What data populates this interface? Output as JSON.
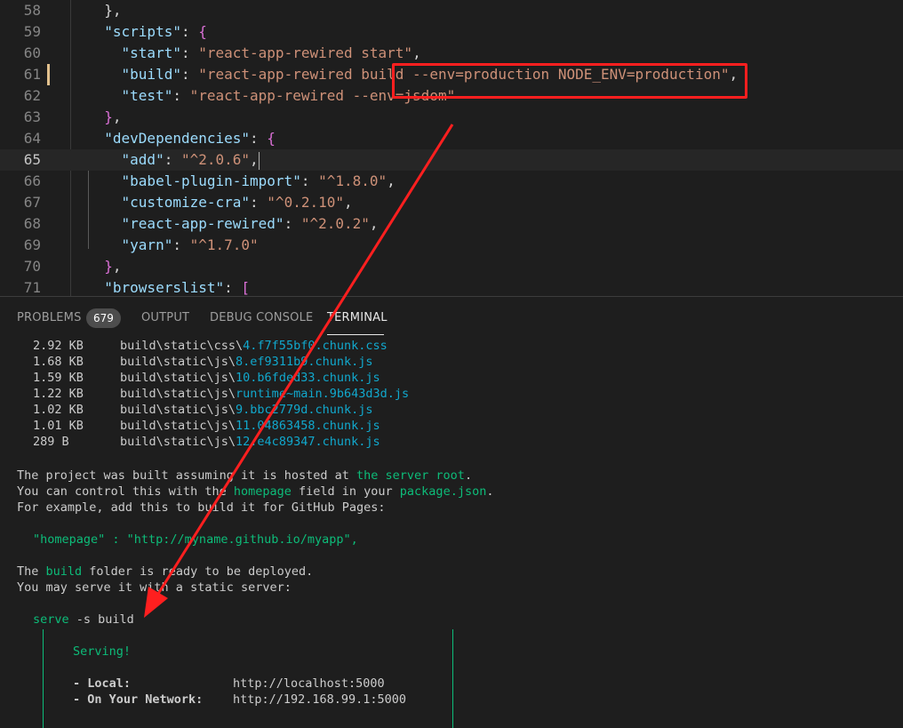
{
  "editor": {
    "lines": [
      {
        "num": "58",
        "parts": [
          [
            "p",
            "  },"
          ]
        ]
      },
      {
        "num": "59",
        "parts": [
          [
            "k",
            "  \"scripts\""
          ],
          [
            "p",
            ": "
          ],
          [
            "b1",
            "{"
          ]
        ]
      },
      {
        "num": "60",
        "parts": [
          [
            "k",
            "    \"start\""
          ],
          [
            "p",
            ": "
          ],
          [
            "s",
            "\"react-app-rewired start\""
          ],
          [
            "p",
            ","
          ]
        ]
      },
      {
        "num": "61",
        "parts": [
          [
            "k",
            "    \"build\""
          ],
          [
            "p",
            ": "
          ],
          [
            "s",
            "\"react-app-rewired build --env=production NODE_ENV=production\""
          ],
          [
            "p",
            ","
          ]
        ]
      },
      {
        "num": "62",
        "parts": [
          [
            "k",
            "    \"test\""
          ],
          [
            "p",
            ": "
          ],
          [
            "s",
            "\"react-app-rewired --env=jsdom\""
          ]
        ]
      },
      {
        "num": "63",
        "parts": [
          [
            "b1",
            "  }"
          ],
          [
            "p",
            ","
          ]
        ]
      },
      {
        "num": "64",
        "parts": [
          [
            "k",
            "  \"devDependencies\""
          ],
          [
            "p",
            ": "
          ],
          [
            "b1",
            "{"
          ]
        ]
      },
      {
        "num": "65",
        "parts": [
          [
            "k",
            "    \"add\""
          ],
          [
            "p",
            ": "
          ],
          [
            "s",
            "\"^2.0.6\""
          ],
          [
            "p",
            ","
          ]
        ]
      },
      {
        "num": "66",
        "parts": [
          [
            "k",
            "    \"babel-plugin-import\""
          ],
          [
            "p",
            ": "
          ],
          [
            "s",
            "\"^1.8.0\""
          ],
          [
            "p",
            ","
          ]
        ]
      },
      {
        "num": "67",
        "parts": [
          [
            "k",
            "    \"customize-cra\""
          ],
          [
            "p",
            ": "
          ],
          [
            "s",
            "\"^0.2.10\""
          ],
          [
            "p",
            ","
          ]
        ]
      },
      {
        "num": "68",
        "parts": [
          [
            "k",
            "    \"react-app-rewired\""
          ],
          [
            "p",
            ": "
          ],
          [
            "s",
            "\"^2.0.2\""
          ],
          [
            "p",
            ","
          ]
        ]
      },
      {
        "num": "69",
        "parts": [
          [
            "k",
            "    \"yarn\""
          ],
          [
            "p",
            ": "
          ],
          [
            "s",
            "\"^1.7.0\""
          ]
        ]
      },
      {
        "num": "70",
        "parts": [
          [
            "b1",
            "  }"
          ],
          [
            "p",
            ","
          ]
        ]
      },
      {
        "num": "71",
        "parts": [
          [
            "k",
            "  \"browserslist\""
          ],
          [
            "p",
            ": "
          ],
          [
            "b1",
            "["
          ]
        ]
      }
    ],
    "active_line": "65"
  },
  "panel": {
    "tabs": {
      "problems": "PROBLEMS",
      "problems_count": "679",
      "output": "OUTPUT",
      "debug": "DEBUG CONSOLE",
      "terminal": "TERMINAL"
    }
  },
  "terminal": {
    "files": [
      {
        "size": "2.92 KB",
        "path": "build\\static\\css\\",
        "name": "4.f7f55bf0.chunk.css"
      },
      {
        "size": "1.68 KB",
        "path": "build\\static\\js\\",
        "name": "8.ef9311b9.chunk.js"
      },
      {
        "size": "1.59 KB",
        "path": "build\\static\\js\\",
        "name": "10.b6fded33.chunk.js"
      },
      {
        "size": "1.22 KB",
        "path": "build\\static\\js\\",
        "name": "runtime~main.9b643d3d.js"
      },
      {
        "size": "1.02 KB",
        "path": "build\\static\\js\\",
        "name": "9.bbc2779d.chunk.js"
      },
      {
        "size": "1.01 KB",
        "path": "build\\static\\js\\",
        "name": "11.04863458.chunk.js"
      },
      {
        "size": "289 B",
        "path": "build\\static\\js\\",
        "name": "12.e4c89347.chunk.js"
      }
    ],
    "msg1_a": "The project was built assuming it is hosted at ",
    "msg1_b": "the server root",
    "msg1_c": ".",
    "msg2_a": "You can control this with the ",
    "msg2_b": "homepage",
    "msg2_c": " field in your ",
    "msg2_d": "package.json",
    "msg2_e": ".",
    "msg3": "For example, add this to build it for GitHub Pages:",
    "homepage_line": "\"homepage\" : \"http://myname.github.io/myapp\",",
    "msg4_a": "The ",
    "msg4_b": "build",
    "msg4_c": " folder is ready to be deployed.",
    "msg5": "You may serve it with a static server:",
    "serve_cmd": "serve",
    "serve_args": " -s build",
    "serving": "Serving!",
    "local_label": "- Local:",
    "local_url": "http://localhost:5000",
    "network_label": "- On Your Network:",
    "network_url": "http://192.168.99.1:5000"
  },
  "colors": {
    "annotation": "#ff1f1f",
    "terminal_green": "#0dbc79"
  }
}
